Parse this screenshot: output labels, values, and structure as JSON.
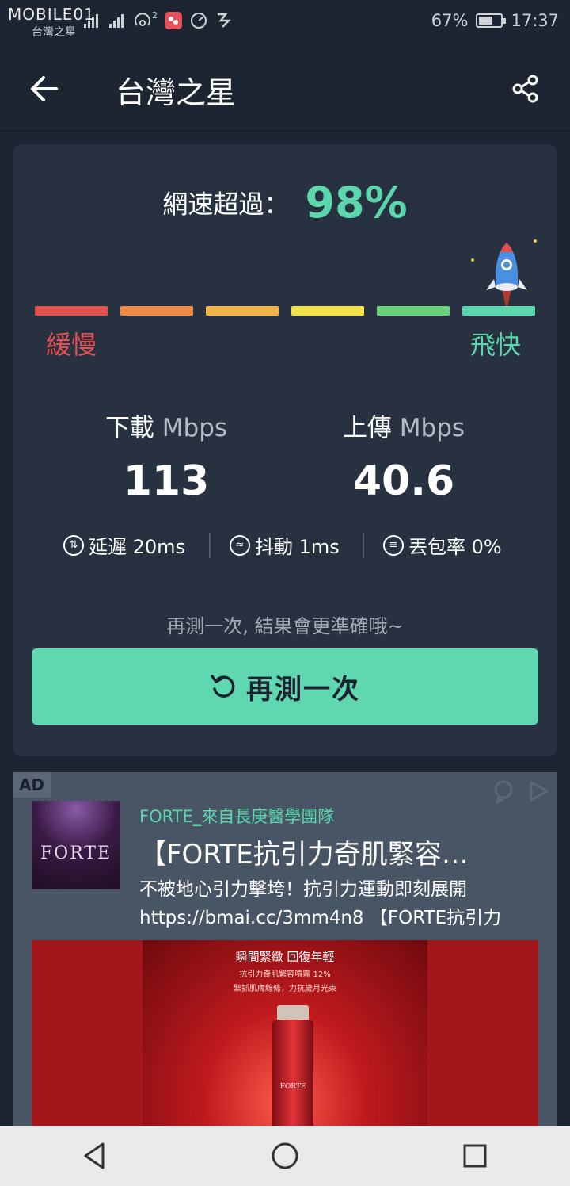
{
  "status_bar": {
    "logo": "MOBILE01",
    "carrier": "台灣之星",
    "signal_sup": "2",
    "battery_text": "67%",
    "battery_level": 0.67,
    "time": "17:37"
  },
  "app_bar": {
    "title": "台灣之星",
    "back_icon": "arrow-left-icon",
    "share_icon": "share-icon"
  },
  "result": {
    "headline_label": "網速超過：",
    "headline_percent": "98%",
    "speed_scale_colors": [
      "#e2504f",
      "#ec8a48",
      "#f0b54a",
      "#f2e24a",
      "#69d17a",
      "#5cd6ad"
    ],
    "scale_slow_label": "緩慢",
    "scale_fast_label": "飛快",
    "download_label": "下載",
    "download_unit": "Mbps",
    "download_value": "113",
    "upload_label": "上傳",
    "upload_unit": "Mbps",
    "upload_value": "40.6",
    "latency_text": "延遲 20ms",
    "jitter_text": "抖動 1ms",
    "packet_loss_text": "丟包率 0%",
    "hint": "再測一次, 結果會更準確哦~",
    "retest_label": "再測一次"
  },
  "ad": {
    "badge": "AD",
    "brand": "FORTE_來自長庚醫學團隊",
    "logo_text": "FORTE",
    "title": "【FORTE抗引力奇肌緊容…",
    "line1": "不被地心引力擊垮！抗引力運動即刻展開",
    "line2": "https://bmai.cc/3mm4n8 【FORTE抗引力",
    "image_title": "瞬間緊緻 回復年輕",
    "image_sub1": "抗引力奇肌緊容噴霧 12%",
    "image_sub2": "緊抓肌膚線條，力抗歲月光束",
    "bottle_text": "FORTE"
  },
  "colors": {
    "background": "#1d2532",
    "card": "#283140",
    "accent": "#5cd6ad",
    "slow": "#e2504f"
  }
}
